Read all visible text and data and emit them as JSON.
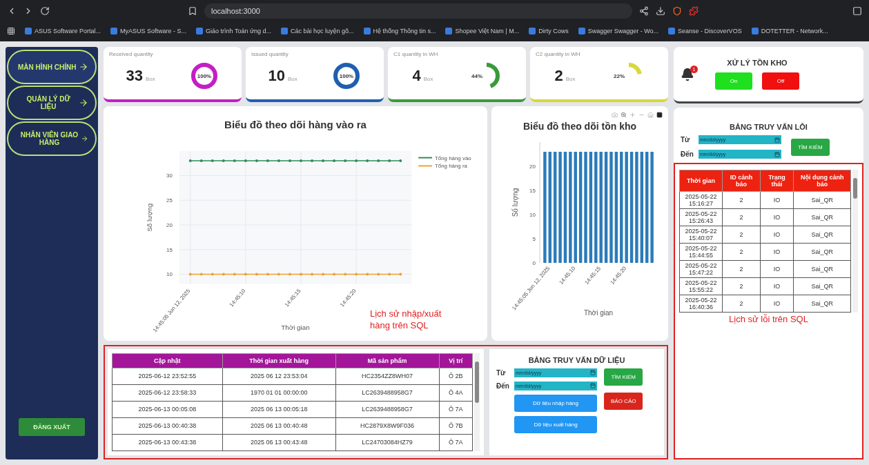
{
  "browser": {
    "url": "localhost:3000",
    "bookmarks": [
      "ASUS Software Portal...",
      "MyASUS Software - S...",
      "Giáo trình Toán ứng d...",
      "Các bài học luyện gõ...",
      "Hệ thống Thông tin s...",
      "Shopee Việt Nam | M...",
      "Dirty Cows",
      "Swagger Swagger - Wo...",
      "Seanse - DiscoverVOS",
      "DOTETTER - Network..."
    ]
  },
  "sidebar": {
    "items": [
      {
        "label": "MÀN HÌNH CHÍNH",
        "selected": true
      },
      {
        "label": "QUẢN LÝ DỮ LIỆU",
        "selected": false
      },
      {
        "label": "NHÂN VIÊN GIAO HÀNG",
        "selected": false
      }
    ],
    "logout": "ĐĂNG XUẤT"
  },
  "kpis": [
    {
      "title": "Received quantity",
      "value": "33",
      "unit": "Box",
      "percent": "100%",
      "level": 1,
      "color": "#c41ec4",
      "kind": "ring"
    },
    {
      "title": "Issued quantity",
      "value": "10",
      "unit": "Box",
      "percent": "100%",
      "level": 1,
      "color": "#1f5fb0",
      "kind": "ring"
    },
    {
      "title": "C1 quantity in WH",
      "value": "4",
      "unit": "Box",
      "percent": "44%",
      "level": 0.44,
      "color": "#3a9a3a",
      "kind": "arc"
    },
    {
      "title": "C2 quantity in WH",
      "value": "2",
      "unit": "Box",
      "percent": "22%",
      "level": 0.22,
      "color": "#d8d83a",
      "kind": "arc"
    }
  ],
  "flow_chart": {
    "chart_data": {
      "type": "line",
      "title": "Biểu đồ theo dõi hàng vào ra",
      "xlabel": "Thời gian",
      "ylabel": "Số lượng",
      "grid": true,
      "legend": "right",
      "series": [
        {
          "name": "Tổng hàng vào",
          "color": "#2e8b57",
          "values": [
            33,
            33,
            33,
            33,
            33,
            33,
            33,
            33,
            33,
            33,
            33,
            33,
            33,
            33,
            33,
            33,
            33,
            33,
            33,
            33
          ]
        },
        {
          "name": "Tổng hàng ra",
          "color": "#f0a030",
          "values": [
            10,
            10,
            10,
            10,
            10,
            10,
            10,
            10,
            10,
            10,
            10,
            10,
            10,
            10,
            10,
            10,
            10,
            10,
            10,
            10
          ]
        }
      ],
      "categories": [
        "14:45:05 Jun 12, 2025",
        null,
        null,
        null,
        null,
        "14:45:10",
        null,
        null,
        null,
        null,
        "14:45:15",
        null,
        null,
        null,
        null,
        "14:45:20",
        null,
        null,
        null,
        null
      ],
      "ylim": [
        8,
        35
      ],
      "yticks": [
        10,
        15,
        20,
        25,
        30
      ]
    }
  },
  "stock_chart": {
    "chart_data": {
      "type": "bar",
      "title": "Biểu đồ theo dõi tồn kho",
      "xlabel": "Thời gian",
      "ylabel": "Số lượng",
      "values": [
        23,
        23,
        23,
        23,
        23,
        23,
        23,
        23,
        23,
        23,
        23,
        23,
        23,
        23,
        23,
        23,
        23,
        23,
        23,
        23,
        23,
        23
      ],
      "categories": [
        null,
        "14:45:05 Jun 12, 2025",
        null,
        null,
        null,
        null,
        "14:45:10",
        null,
        null,
        null,
        null,
        "14:45:15",
        null,
        null,
        null,
        null,
        "14:45:20",
        null,
        null,
        null,
        null,
        null
      ],
      "ylim": [
        0,
        25
      ],
      "yticks": [
        0,
        5,
        10,
        15,
        20
      ]
    }
  },
  "io_table": {
    "columns": [
      "Cập nhật",
      "Thời gian xuất hàng",
      "Mã sản phẩm",
      "Vị trí"
    ],
    "rows": [
      [
        "2025-06-12 23:52:55",
        "2025 06 12 23:53:04",
        "HC2354ZZ8WH07",
        "Ô 2B"
      ],
      [
        "2025-06-12 23:58:33",
        "1970 01 01 00:00:00",
        "LC2639488958G7",
        "Ô 4A"
      ],
      [
        "2025-06-13 00:05:08",
        "2025 06 13 00:05:18",
        "LC2639488958G7",
        "Ô 7A"
      ],
      [
        "2025-06-13 00:40:38",
        "2025 06 13 00:40:48",
        "HC2879X8W9F036",
        "Ô 7B"
      ],
      [
        "2025-06-13 00:43:38",
        "2025 06 13 00:43:48",
        "LC24703084HZ79",
        "Ô 7A"
      ]
    ]
  },
  "data_query": {
    "title": "BẢNG TRUY VẤN DỮ LIỆU",
    "from_label": "Từ",
    "to_label": "Đến",
    "from": {
      "placeholder": "mm/dd/yyyy"
    },
    "to": {
      "placeholder": "mm/dd/yyyy"
    },
    "search": "TÌM KIẾM",
    "report": "BÁO CÁO",
    "import_button": "Dữ liệu nhập hàng",
    "export_button": "Dữ liệu xuất hàng"
  },
  "stock_control": {
    "title": "XỬ LÝ TỒN KHO",
    "on": "On",
    "off": "Off",
    "alert_count": "1"
  },
  "error_query": {
    "title": "BẢNG TRUY VẤN LỖI",
    "from_label": "Từ",
    "to_label": "Đến",
    "from": {
      "placeholder": "mm/dd/yyyy"
    },
    "to": {
      "placeholder": "mm/dd/yyyy"
    },
    "search": "TÌM KIẾM"
  },
  "error_table": {
    "columns": [
      "Thời gian",
      "ID cảnh báo",
      "Trạng thái",
      "Nội dung cảnh báo"
    ],
    "rows": [
      [
        "2025-05-22 15:16:27",
        "2",
        "IO",
        "Sai_QR"
      ],
      [
        "2025-05-22 15:26:43",
        "2",
        "IO",
        "Sai_QR"
      ],
      [
        "2025-05-22 15:40:07",
        "2",
        "IO",
        "Sai_QR"
      ],
      [
        "2025-05-22 15:44:55",
        "2",
        "IO",
        "Sai_QR"
      ],
      [
        "2025-05-22 15:47:22",
        "2",
        "IO",
        "Sai_QR"
      ],
      [
        "2025-05-22 15:55:22",
        "2",
        "IO",
        "Sai_QR"
      ],
      [
        "2025-05-22 16:40:36",
        "2",
        "IO",
        "Sai_QR"
      ]
    ]
  },
  "annotations": [
    {
      "text": "Lịch sử nhập/xuất hàng trên SQL"
    },
    {
      "text": "Lịch sử lỗi trên SQL"
    }
  ]
}
